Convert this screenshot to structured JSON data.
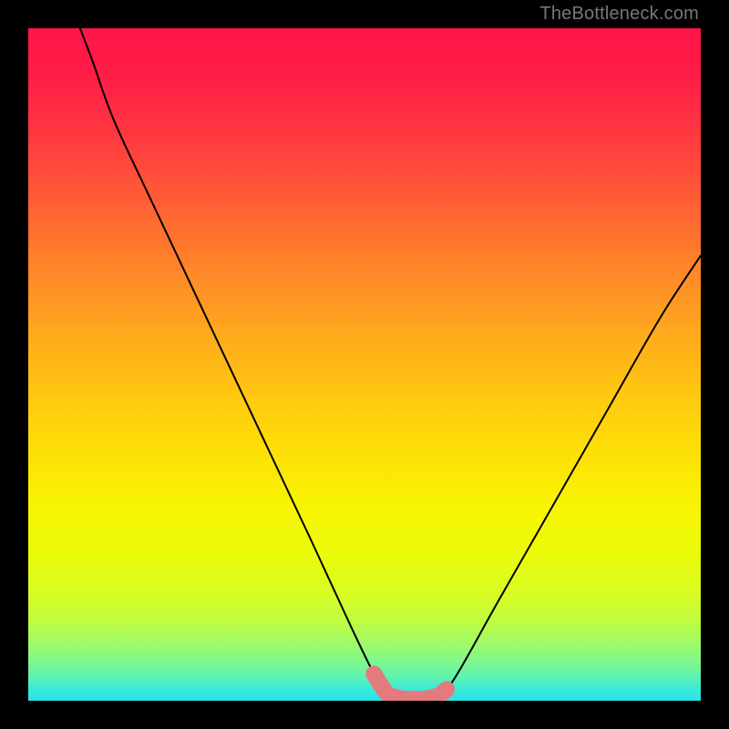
{
  "watermark": "TheBottleneck.com",
  "chart_data": {
    "type": "line",
    "title": "",
    "xlabel": "",
    "ylabel": "",
    "xlim": [
      0,
      100
    ],
    "ylim": [
      0,
      100
    ],
    "series": [
      {
        "name": "bottleneck-curve",
        "color": "#000000",
        "points": [
          {
            "x": 7.7,
            "y": 100
          },
          {
            "x": 9.6,
            "y": 95
          },
          {
            "x": 12.7,
            "y": 86.4
          },
          {
            "x": 18.0,
            "y": 75.0
          },
          {
            "x": 26.0,
            "y": 58.0
          },
          {
            "x": 34.0,
            "y": 41.0
          },
          {
            "x": 42.0,
            "y": 24.0
          },
          {
            "x": 48.0,
            "y": 11.0
          },
          {
            "x": 51.4,
            "y": 4.0
          },
          {
            "x": 53.0,
            "y": 1.5
          },
          {
            "x": 54.0,
            "y": 0.7
          },
          {
            "x": 56.0,
            "y": 0.3
          },
          {
            "x": 59.0,
            "y": 0.3
          },
          {
            "x": 61.0,
            "y": 0.8
          },
          {
            "x": 62.2,
            "y": 1.7
          },
          {
            "x": 64.4,
            "y": 5.0
          },
          {
            "x": 70.0,
            "y": 15.0
          },
          {
            "x": 78.0,
            "y": 29.0
          },
          {
            "x": 86.0,
            "y": 43.0
          },
          {
            "x": 94.0,
            "y": 57.0
          },
          {
            "x": 100.0,
            "y": 66.2
          }
        ]
      },
      {
        "name": "optimal-zone-highlight",
        "color": "#e47a7e",
        "stroke_width": 10,
        "points": [
          {
            "x": 51.4,
            "y": 4.0
          },
          {
            "x": 53.0,
            "y": 1.5
          },
          {
            "x": 54.0,
            "y": 0.7
          },
          {
            "x": 56.0,
            "y": 0.3
          },
          {
            "x": 59.0,
            "y": 0.3
          },
          {
            "x": 61.0,
            "y": 0.8
          },
          {
            "x": 62.2,
            "y": 1.7
          }
        ]
      }
    ]
  }
}
